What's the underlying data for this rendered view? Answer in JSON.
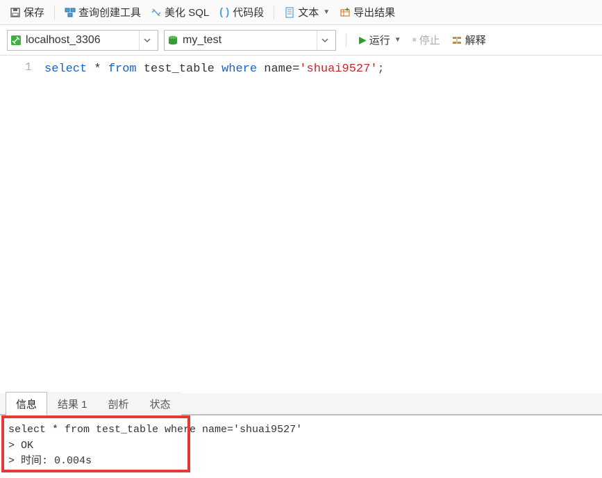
{
  "toolbar1": {
    "save": "保存",
    "query_builder": "查询创建工具",
    "beautify": "美化 SQL",
    "snippet": "代码段",
    "text": "文本",
    "export": "导出结果"
  },
  "toolbar2": {
    "connection": "localhost_3306",
    "database": "my_test",
    "run": "运行",
    "stop": "停止",
    "explain": "解释"
  },
  "editor": {
    "line_number": "1",
    "sql": {
      "p1": "select",
      "p2": " * ",
      "p3": "from",
      "p4": " test_table ",
      "p5": "where",
      "p6": " name=",
      "p7": "'shuai9527'",
      "p8": ";"
    }
  },
  "tabs": {
    "info": "信息",
    "result": "结果 1",
    "profile": "剖析",
    "status": "状态"
  },
  "output": {
    "line1": "select * from test_table where name='shuai9527'",
    "line2": "> OK",
    "line3": "> 时间: 0.004s"
  }
}
